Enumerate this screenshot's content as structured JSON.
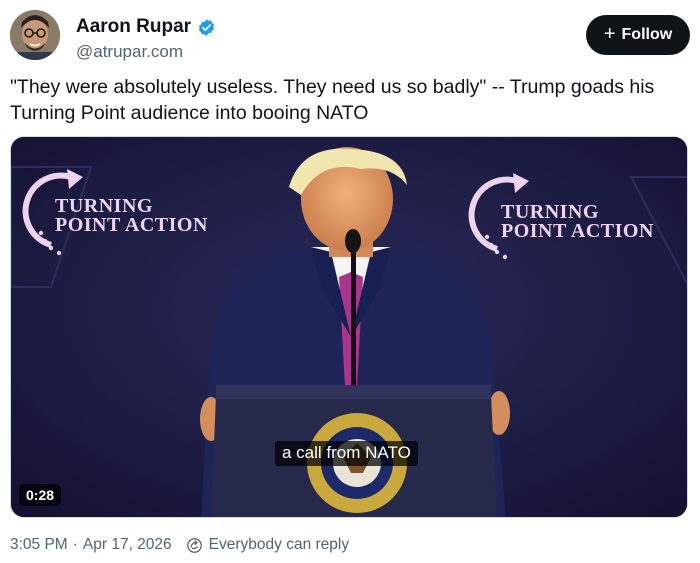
{
  "author": {
    "display_name": "Aaron Rupar",
    "handle": "@atrupar.com",
    "verified": true
  },
  "follow": {
    "label": "Follow",
    "icon": "plus-icon"
  },
  "post": {
    "text": "\"They were absolutely useless. They need us so badly\" -- Trump goads his Turning Point audience into booing NATO"
  },
  "video": {
    "caption": "a call from NATO",
    "duration": "0:28",
    "branding_line1": "TURNING",
    "branding_line2": "POINT ACTION",
    "seal_text": "SEAL OF THE PRESIDENT OF THE UNITED STATES"
  },
  "footer": {
    "time": "3:05 PM",
    "separator": "·",
    "date": "Apr 17, 2026",
    "reply_setting": "Everybody can reply"
  },
  "colors": {
    "follow_bg": "#0f1419",
    "verified_blue": "#1d9bf0",
    "muted_text": "#536471",
    "stage_bg": "#17163a",
    "brand_pink": "#efd2ef"
  }
}
